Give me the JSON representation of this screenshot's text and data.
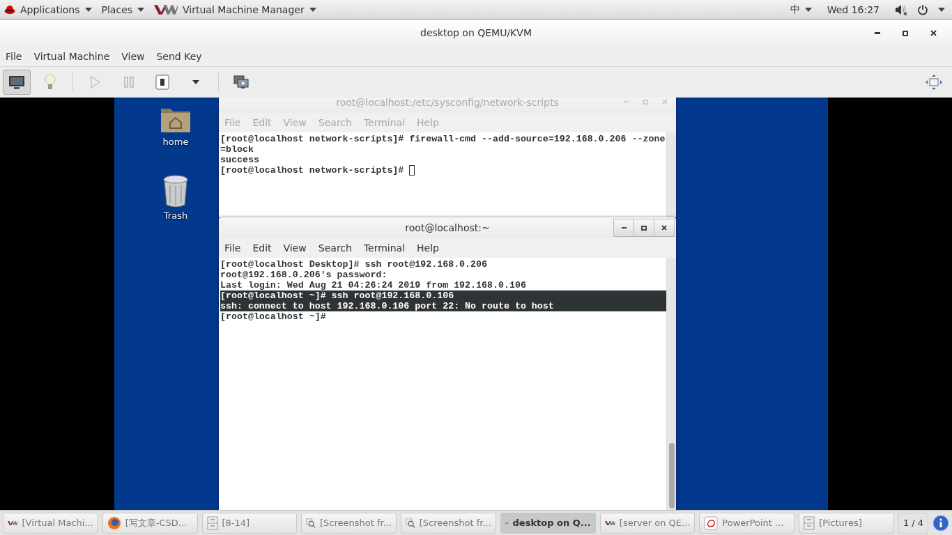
{
  "top_bar": {
    "menus": [
      {
        "label": "Applications",
        "kind": "apps"
      },
      {
        "label": "Places",
        "kind": "plain"
      },
      {
        "label": "Virtual Machine Manager",
        "kind": "vm"
      }
    ],
    "input_method": "中",
    "clock": "Wed 16:27"
  },
  "window": {
    "title": "desktop on QEMU/KVM",
    "menu": [
      "File",
      "Virtual Machine",
      "View",
      "Send Key"
    ],
    "toolbar": [
      {
        "kind": "console",
        "selected": true
      },
      {
        "kind": "details",
        "selected": false
      },
      {
        "kind": "run",
        "selected": false
      },
      {
        "kind": "pause",
        "selected": false
      },
      {
        "kind": "shutdown",
        "selected": false
      },
      {
        "kind": "dropdown",
        "selected": false
      },
      {
        "kind": "snapshots",
        "selected": false
      }
    ]
  },
  "desktop_icons": [
    {
      "label": "home",
      "kind": "folder"
    },
    {
      "label": "Trash",
      "kind": "trash"
    }
  ],
  "terminals": [
    {
      "title": "root@localhost:/etc/sysconfig/network-scripts",
      "focused": false,
      "menu": [
        "File",
        "Edit",
        "View",
        "Search",
        "Terminal",
        "Help"
      ],
      "lines": [
        {
          "text": "[root@localhost network-scripts]# firewall-cmd --add-source=192.168.0.206 --zone",
          "selected": false,
          "cursor": false
        },
        {
          "text": "=block",
          "selected": false,
          "cursor": false
        },
        {
          "text": "success",
          "selected": false,
          "cursor": false
        },
        {
          "text": "[root@localhost network-scripts]# ",
          "selected": false,
          "cursor": true
        }
      ]
    },
    {
      "title": "root@localhost:~",
      "focused": true,
      "menu": [
        "File",
        "Edit",
        "View",
        "Search",
        "Terminal",
        "Help"
      ],
      "lines": [
        {
          "text": "[root@localhost Desktop]# ssh root@192.168.0.206",
          "selected": false,
          "cursor": false
        },
        {
          "text": "root@192.168.0.206's password:",
          "selected": false,
          "cursor": false
        },
        {
          "text": "Last login: Wed Aug 21 04:26:24 2019 from 192.168.0.106",
          "selected": false,
          "cursor": false
        },
        {
          "text": "[root@localhost ~]# ssh root@192.168.0.106",
          "selected": true,
          "cursor": false
        },
        {
          "text": "ssh: connect to host 192.168.0.106 port 22: No route to host",
          "selected": true,
          "cursor": false
        },
        {
          "text": "[root@localhost ~]#",
          "selected": false,
          "cursor": false
        }
      ]
    }
  ],
  "taskbar": {
    "items": [
      {
        "label": "[Virtual Machi...",
        "kind": "vm",
        "selected": false
      },
      {
        "label": "[写文章-CSD...",
        "kind": "browser",
        "selected": false
      },
      {
        "label": "[8-14]",
        "kind": "files",
        "selected": false
      },
      {
        "label": "[Screenshot fr...",
        "kind": "screenshot",
        "selected": false
      },
      {
        "label": "[Screenshot fr...",
        "kind": "screenshot",
        "selected": false
      },
      {
        "label": "desktop on Q...",
        "kind": "vm",
        "selected": true
      },
      {
        "label": "[server on QE...",
        "kind": "vm",
        "selected": false
      },
      {
        "label": "PowerPoint ...",
        "kind": "slides",
        "selected": false
      },
      {
        "label": "[Pictures]",
        "kind": "files",
        "selected": false
      }
    ],
    "workspace": "1 / 4"
  }
}
